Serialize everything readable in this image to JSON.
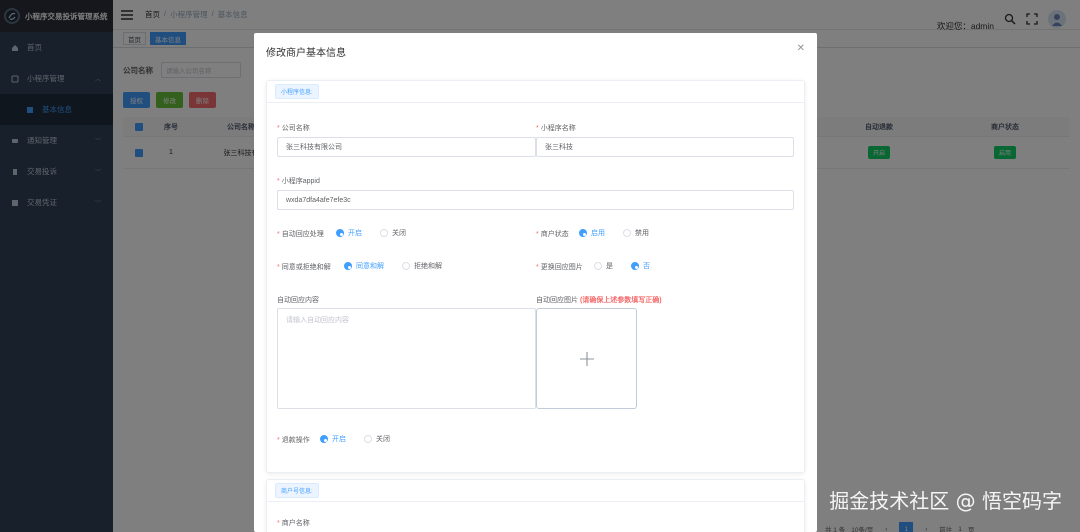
{
  "app": {
    "title": "小程序交易投诉管理系统"
  },
  "sidebar": {
    "items": [
      {
        "label": "首页",
        "icon": "home-icon"
      },
      {
        "label": "小程序管理",
        "icon": "app-icon"
      },
      {
        "label": "基本信息",
        "icon": "info-icon"
      },
      {
        "label": "通知管理",
        "icon": "notify-icon"
      },
      {
        "label": "交易投诉",
        "icon": "complaint-icon"
      },
      {
        "label": "交易凭证",
        "icon": "voucher-icon"
      }
    ]
  },
  "navbar": {
    "breadcrumb": [
      "首页",
      "小程序管理",
      "基本信息"
    ],
    "welcome": "欢迎您：admin"
  },
  "tags": [
    "首页",
    "基本信息"
  ],
  "search": {
    "label": "公司名称",
    "placeholder": "请输入公司名称"
  },
  "toolbar": {
    "add": "授权",
    "edit": "修改",
    "delete": "删除"
  },
  "table": {
    "headers": [
      "序号",
      "公司名称",
      "自动退款",
      "商户状态"
    ],
    "rows": [
      {
        "idx": "1",
        "name": "张三科技有",
        "refund": "开启",
        "status": "启用"
      }
    ]
  },
  "pager": {
    "total": "共 1 条",
    "size": "10条/页",
    "page": "1",
    "goto": "前往",
    "goto_page": "1",
    "goto_suffix": "页"
  },
  "dialog": {
    "title": "修改商户基本信息",
    "section1": "小程序信息:",
    "section2": "商户号信息:",
    "company_label": "公司名称",
    "company_value": "张三科技有限公司",
    "app_name_label": "小程序名称",
    "app_name_value": "张三科技",
    "appid_label": "小程序appid",
    "appid_value": "wxda7dfa4afe7efe3c",
    "auto_label": "自动回应处理",
    "auto_on": "开启",
    "auto_off": "关闭",
    "merchant_status_label": "商户状态",
    "status_on": "启用",
    "status_off": "禁用",
    "agree_label": "同意或拒绝和解",
    "agree_yes": "同意和解",
    "agree_no": "拒绝和解",
    "pic_change_label": "更换回应图片",
    "pic_yes": "是",
    "pic_no": "否",
    "content_label": "自动回应内容",
    "content_placeholder": "请输入自动回应内容",
    "pic_label": "自动回应图片",
    "pic_warning": "(请确保上述参数填写正确)",
    "refund_label": "退款操作",
    "refund_on": "开启",
    "refund_off": "关闭",
    "merchant_name_label": "商户名称"
  },
  "watermark": "掘金技术社区 @ 悟空码字"
}
